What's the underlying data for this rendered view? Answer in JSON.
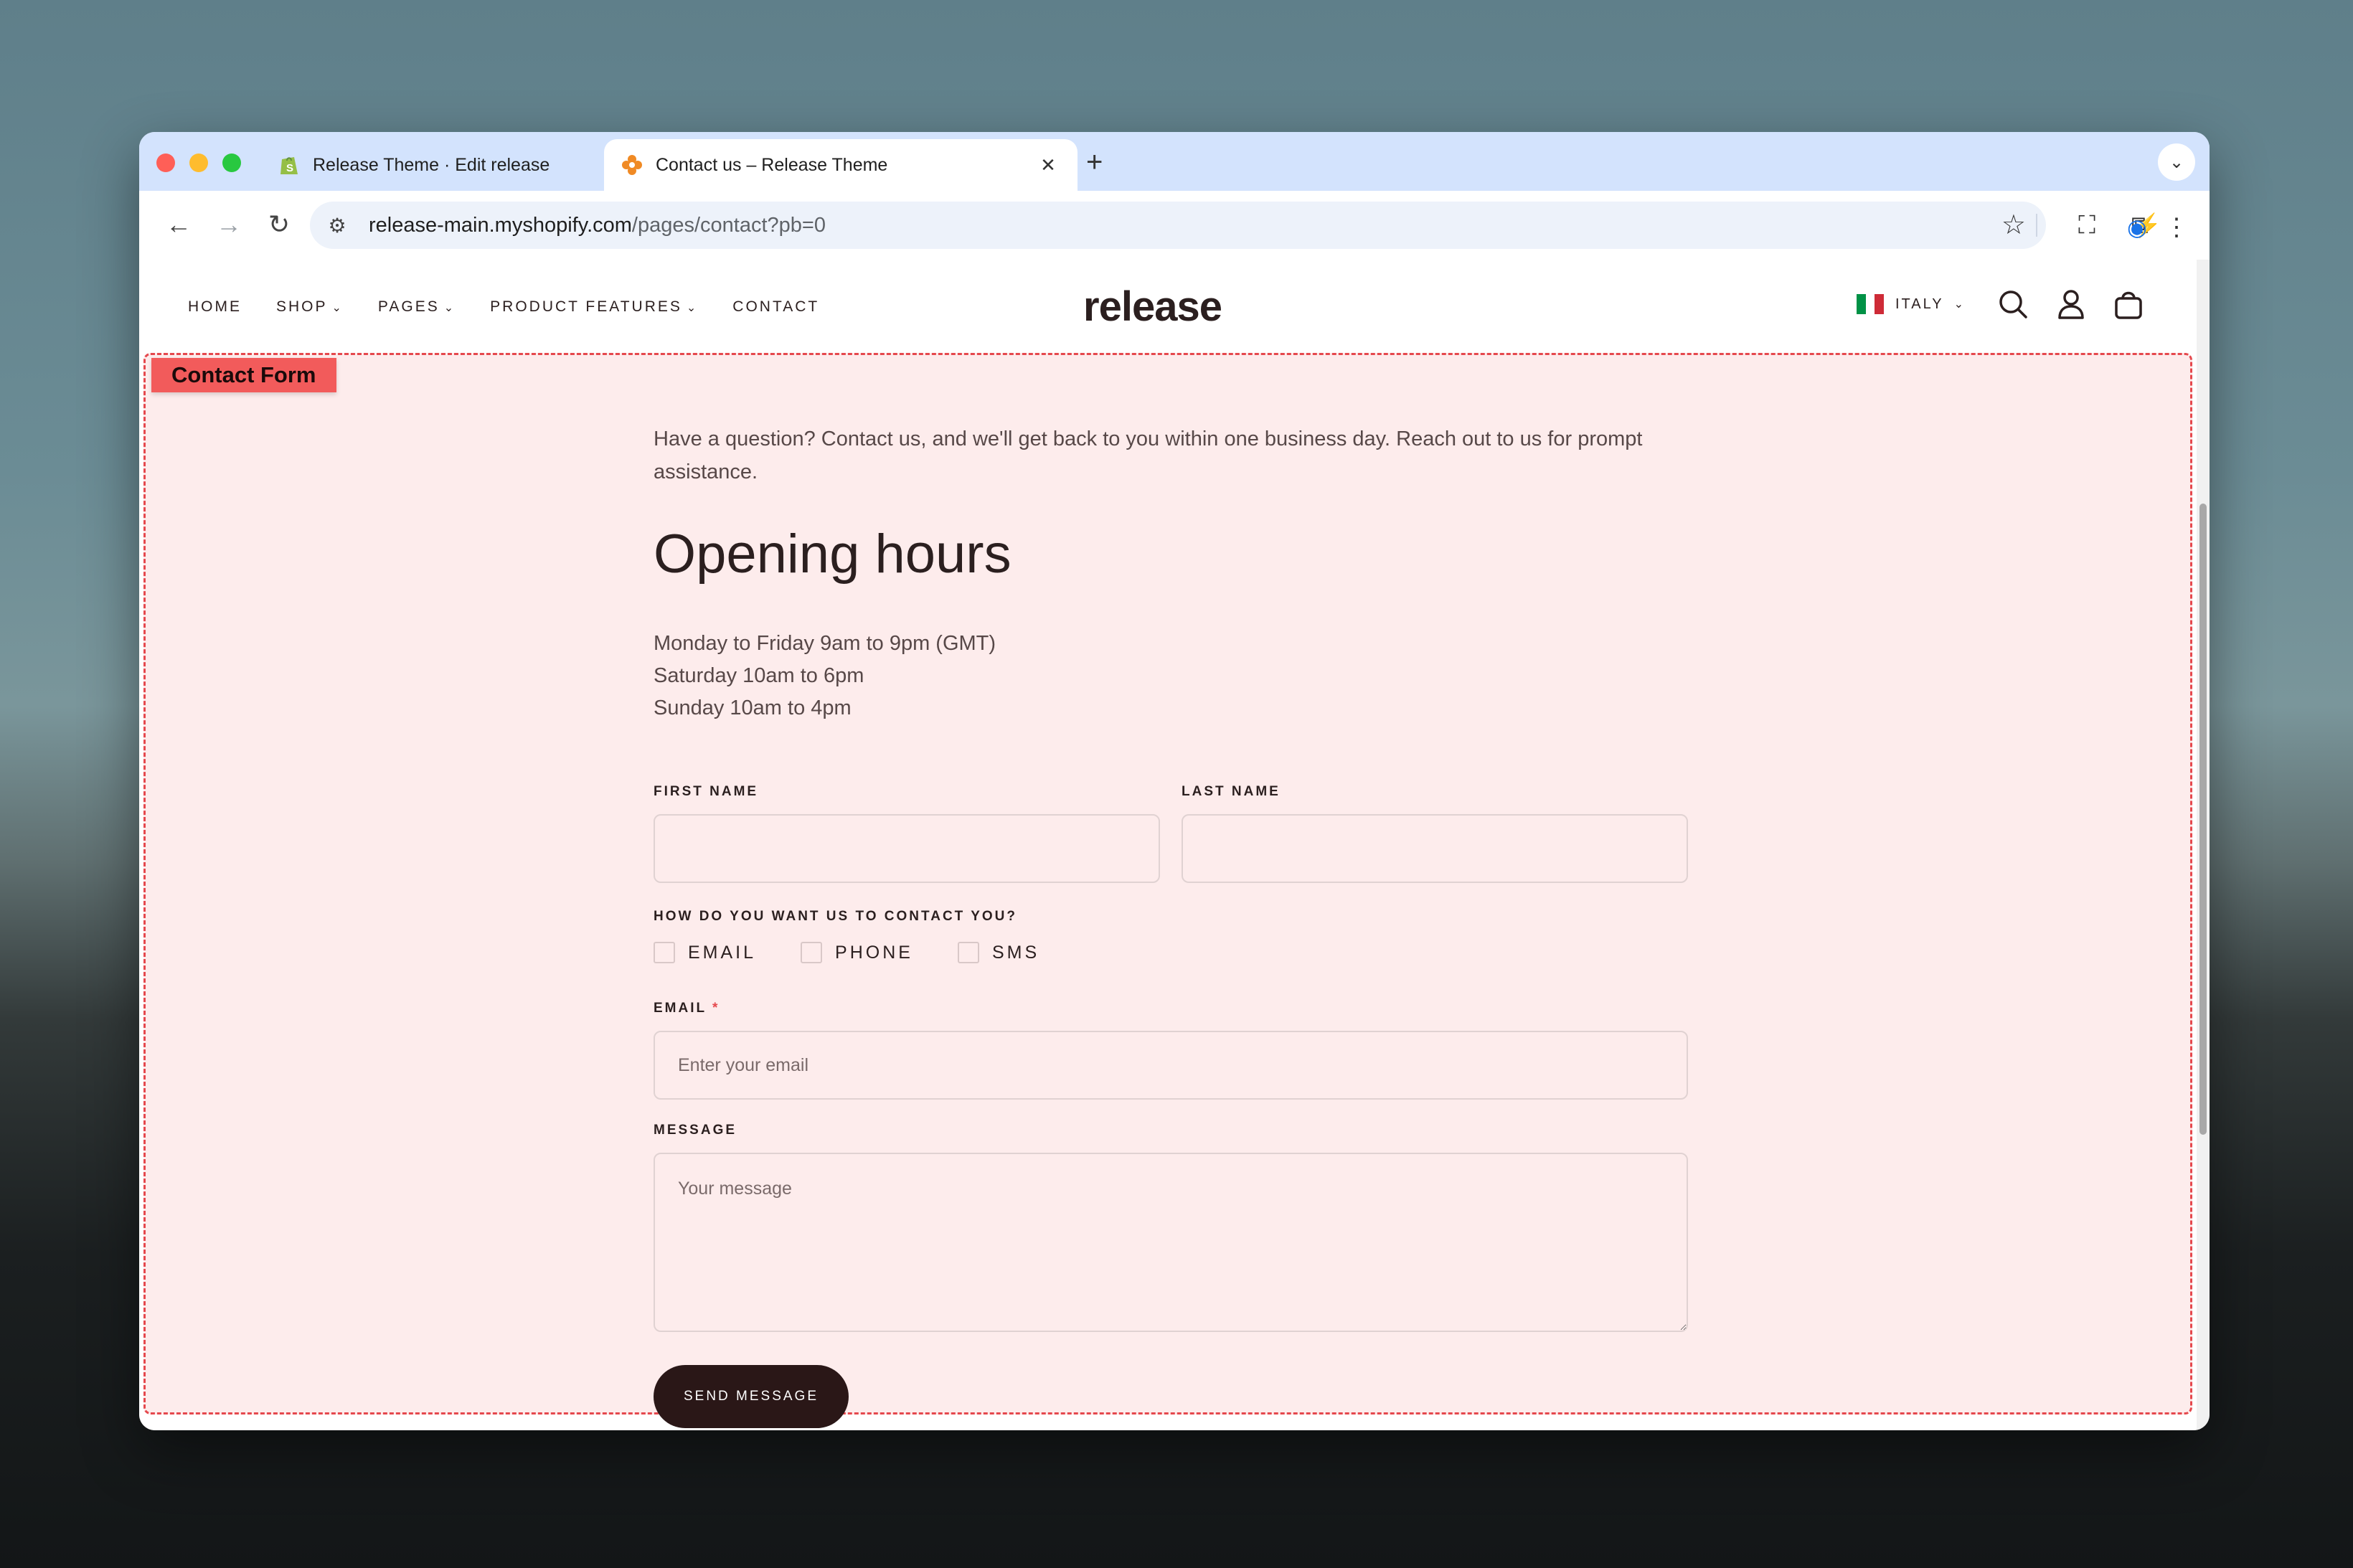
{
  "browser": {
    "tabs": [
      {
        "title": "Release Theme · Edit release",
        "icon": "shopify-icon",
        "active": false,
        "close": "✕"
      },
      {
        "title": "Contact us – Release Theme",
        "icon": "release-theme-favicon",
        "active": true,
        "close": "✕"
      }
    ],
    "new_tab": "+",
    "url_host": "release-main.myshopify.com",
    "url_path": "/pages/contact?pb=0"
  },
  "site": {
    "logo": "release",
    "nav": [
      {
        "label": "HOME",
        "has_dropdown": false
      },
      {
        "label": "SHOP",
        "has_dropdown": true
      },
      {
        "label": "PAGES",
        "has_dropdown": true
      },
      {
        "label": "PRODUCT FEATURES",
        "has_dropdown": true
      },
      {
        "label": "CONTACT",
        "has_dropdown": false
      }
    ],
    "locale": "ITALY",
    "colors": {
      "accent": "#2a1717",
      "overlay": "#fdecec",
      "overlay_border": "#e5484d",
      "tag": "#f25b5b"
    }
  },
  "overlay": {
    "label": "Contact Form"
  },
  "contact": {
    "intro": "Have a question? Contact us, and we'll get back to you within one business day. Reach out to us for prompt assistance.",
    "heading": "Opening hours",
    "hours": [
      "Monday to Friday 9am to 9pm (GMT)",
      "Saturday 10am to 6pm",
      "Sunday 10am to 4pm"
    ],
    "form": {
      "first_name_label": "FIRST NAME",
      "first_name_value": "",
      "last_name_label": "LAST NAME",
      "last_name_value": "",
      "contact_method_label": "HOW DO YOU WANT US TO CONTACT YOU?",
      "options": [
        {
          "label": "EMAIL",
          "checked": false
        },
        {
          "label": "PHONE",
          "checked": false
        },
        {
          "label": "SMS",
          "checked": false
        }
      ],
      "email_label": "EMAIL",
      "email_required_mark": "*",
      "email_placeholder": "Enter your email",
      "message_label": "MESSAGE",
      "message_placeholder": "Your message",
      "submit": "SEND MESSAGE"
    }
  }
}
